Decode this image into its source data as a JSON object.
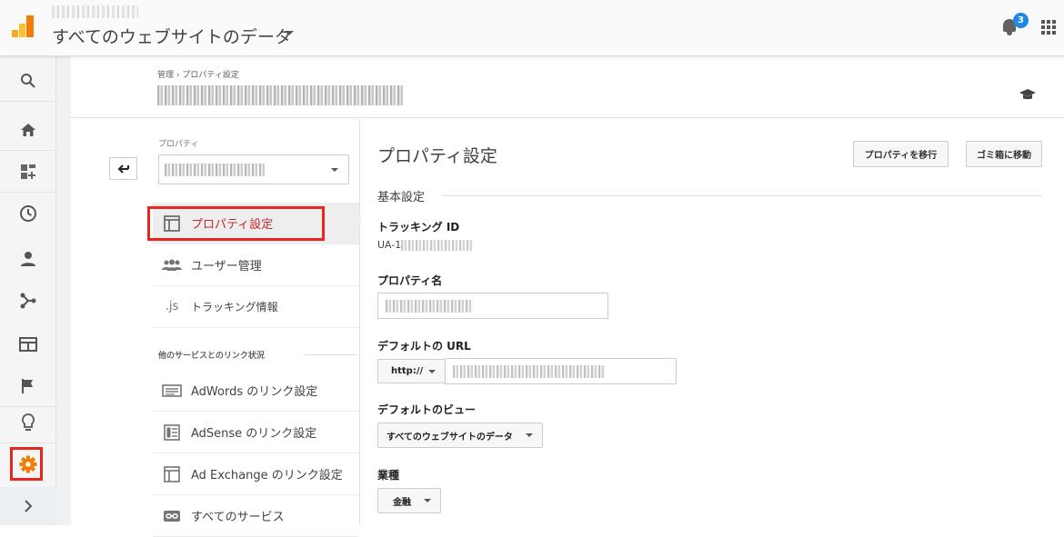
{
  "header": {
    "view_title": "すべてのウェブサイトのデータ",
    "notification_count": "3"
  },
  "breadcrumb": {
    "admin": "管理",
    "separator": "›",
    "current": "プロパティ設定"
  },
  "admin_nav": {
    "property_label": "プロパティ",
    "items": [
      {
        "label": "プロパティ設定",
        "icon": "property-settings-icon"
      },
      {
        "label": "ユーザー管理",
        "icon": "users-icon"
      },
      {
        "label": "トラッキング情報",
        "icon": "js-icon",
        "icon_text": ".js"
      }
    ],
    "linking_section_title": "他のサービスとのリンク状況",
    "linking_items": [
      {
        "label": "AdWords のリンク設定",
        "icon": "adwords-icon"
      },
      {
        "label": "AdSense のリンク設定",
        "icon": "adsense-icon"
      },
      {
        "label": "Ad Exchange のリンク設定",
        "icon": "ad-exchange-icon"
      },
      {
        "label": "すべてのサービス",
        "icon": "link-icon"
      }
    ]
  },
  "main": {
    "page_title": "プロパティ設定",
    "move_property_button": "プロパティを移行",
    "trash_button": "ゴミ箱に移動",
    "basic_settings": "基本設定",
    "tracking_id_label": "トラッキング ID",
    "tracking_id_prefix": "UA-1",
    "property_name_label": "プロパティ名",
    "default_url_label": "デフォルトの URL",
    "url_protocol": "http://",
    "default_view_label": "デフォルトのビュー",
    "default_view_value": "すべてのウェブサイトのデータ",
    "industry_label": "業種",
    "industry_value": "金融"
  },
  "colors": {
    "highlight": "#e8251e",
    "settings_gear": "#f57c00",
    "active_text": "#c62828",
    "badge": "#1e88e5"
  }
}
